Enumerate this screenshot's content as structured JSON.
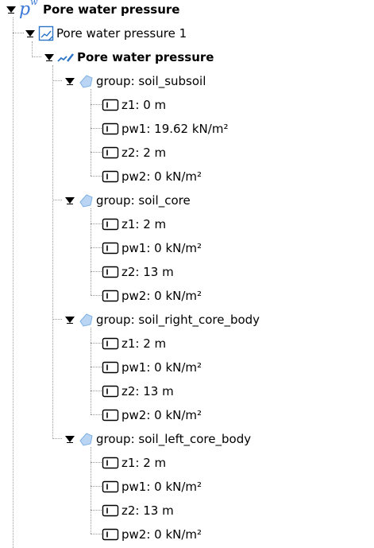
{
  "tree": {
    "root": {
      "icon_text": "p",
      "icon_sup": "w",
      "label": "Pore water pressure"
    },
    "child": {
      "label": "Pore water pressure 1"
    },
    "subchild": {
      "label": "Pore water pressure"
    },
    "groups": [
      {
        "label": "group: soil_subsoil",
        "params": [
          "z1: 0 m",
          "pw1: 19.62 kN/m²",
          "z2: 2 m",
          "pw2: 0 kN/m²"
        ]
      },
      {
        "label": "group: soil_core",
        "params": [
          "z1: 2 m",
          "pw1: 0 kN/m²",
          "z2: 13 m",
          "pw2: 0 kN/m²"
        ]
      },
      {
        "label": "group: soil_right_core_body",
        "params": [
          "z1: 2 m",
          "pw1: 0 kN/m²",
          "z2: 13 m",
          "pw2: 0 kN/m²"
        ]
      },
      {
        "label": "group: soil_left_core_body",
        "params": [
          "z1: 2 m",
          "pw1: 0 kN/m²",
          "z2: 13 m",
          "pw2: 0 kN/m²"
        ]
      }
    ]
  },
  "colors": {
    "icon_blue": "#2b74c7",
    "group_icon": "#9cc3ec",
    "tree_line": "#9a9a9a"
  }
}
